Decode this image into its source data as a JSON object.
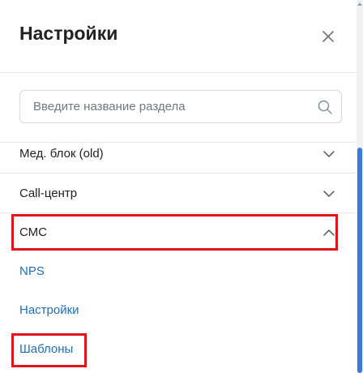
{
  "panel": {
    "title": "Настройки",
    "close_icon": "close-icon"
  },
  "search": {
    "placeholder": "Введите название раздела",
    "value": "",
    "icon": "search-icon"
  },
  "menu": {
    "items": [
      {
        "label": "Мед. блок (old)",
        "state": "collapsed",
        "icon": "chevron-down-icon"
      },
      {
        "label": "Call-центр",
        "state": "collapsed",
        "icon": "chevron-down-icon"
      },
      {
        "label": "СМС",
        "state": "expanded",
        "icon": "chevron-up-icon",
        "highlighted": true
      }
    ],
    "subitems": [
      {
        "label": "NPS"
      },
      {
        "label": "Настройки"
      },
      {
        "label": "Шаблоны",
        "highlighted": true
      }
    ]
  },
  "colors": {
    "link": "#1f6fbd",
    "highlight": "#e0141b",
    "scroll_thumb": "#3f7ad8"
  }
}
